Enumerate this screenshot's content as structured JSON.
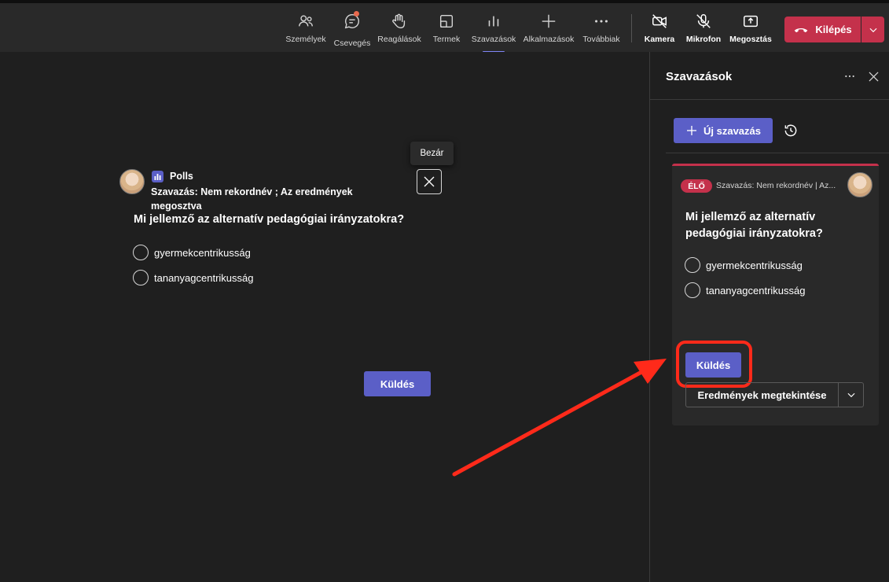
{
  "toolbar": {
    "items": [
      {
        "label": "Személyek",
        "icon": "people-icon"
      },
      {
        "label": "Csevegés",
        "icon": "chat-icon"
      },
      {
        "label": "Reagálások",
        "icon": "reaction-hand-icon"
      },
      {
        "label": "Termek",
        "icon": "rooms-icon"
      },
      {
        "label": "Szavazások",
        "icon": "polls-icon"
      },
      {
        "label": "Alkalmazások",
        "icon": "plus-icon"
      },
      {
        "label": "Továbbiak",
        "icon": "more-icon"
      },
      {
        "label": "Kamera",
        "icon": "camera-off-icon"
      },
      {
        "label": "Mikrofon",
        "icon": "mic-off-icon"
      },
      {
        "label": "Megosztás",
        "icon": "share-icon"
      }
    ],
    "leave_label": "Kilépés"
  },
  "stage": {
    "tooltip": "Bezár",
    "app_name": "Polls",
    "subtitle": "Szavazás: Nem rekordnév ; Az eredmények megosztva",
    "question": "Mi jellemző az alternatív pedagógiai irányzatokra?",
    "options": [
      "gyermekcentrikusság",
      "tananyagcentrikusság"
    ],
    "send_label": "Küldés"
  },
  "panel": {
    "title": "Szavazások",
    "new_poll_label": "Új szavazás",
    "card": {
      "live_badge": "ÉLŐ",
      "subtitle": "Szavazás: Nem rekordnév | Az...",
      "question": "Mi jellemző az alternatív pedagógiai irányzatokra?",
      "options": [
        "gyermekcentrikusság",
        "tananyagcentrikusság"
      ],
      "send_label": "Küldés",
      "results_label": "Eredmények megtekintése"
    }
  },
  "colors": {
    "accent": "#5b5fc7",
    "leave": "#c4314b",
    "live": "#c4314b",
    "annotation": "#ff2a1a"
  }
}
